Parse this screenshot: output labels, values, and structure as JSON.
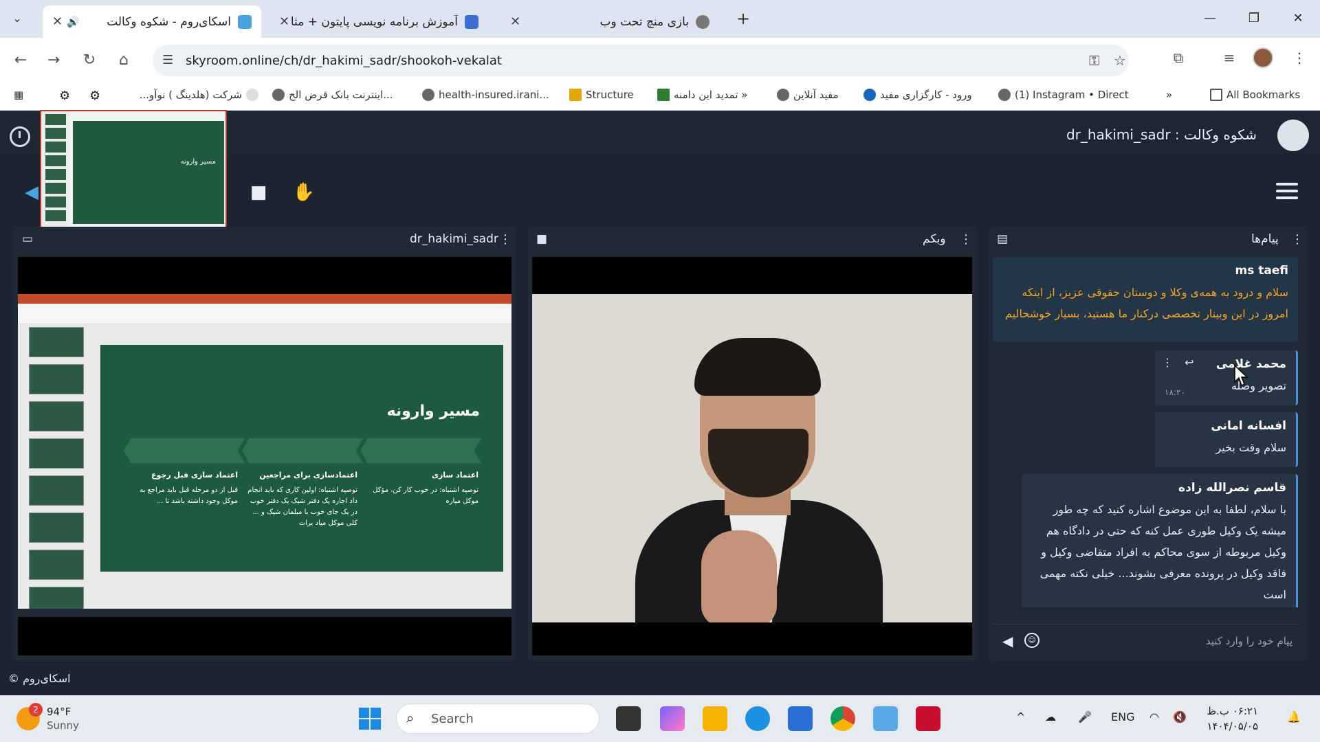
{
  "browser": {
    "tabs": [
      {
        "title": "اسکای‌روم - شکوه وکالت",
        "active": true
      },
      {
        "title": "آموزش برنامه نویسی پایتون + مثا",
        "active": false
      },
      {
        "title": "بازی منچ تحت وب",
        "active": false
      }
    ],
    "new_tab_label": "+",
    "url": "skyroom.online/ch/dr_hakimi_sadr/shookoh-vekalat",
    "window_controls": {
      "minimize": "—",
      "restore": "❐",
      "close": "✕"
    }
  },
  "bookmarks": [
    {
      "label": "شرکت (هلدینگ ) نوآو..."
    },
    {
      "label": "اینترنت بانک قرض الح..."
    },
    {
      "label": "health-insured.irani..."
    },
    {
      "label": "Structure"
    },
    {
      "label": "تمدید این دامنه »"
    },
    {
      "label": "مفید آنلاین"
    },
    {
      "label": "ورود - کارگزاری مفید"
    },
    {
      "label": "(1) Instagram • Direct"
    }
  ],
  "bookmarks_more": "»",
  "all_bookmarks": "All Bookmarks",
  "room": {
    "title": "dr_hakimi_sadr : شکوه وکالت"
  },
  "screen_panel": {
    "title": "dr_hakimi_sadr",
    "slide_title": "مسیر وارونه",
    "columns": [
      {
        "heading": "اعتماد سازی",
        "body": "توصیه اشتباه:\nدر خوب کار کن، مؤکل موکل میاره"
      },
      {
        "heading": "اعتمادسازی برای مراجعین",
        "body": "توصیه اشتباه:\nاولین کاری که باید انجام داد اجاره یک دفتر شیک یک دفتر خوب در یک جای خوب با مبلمان شیک و ... کلی موکل میاد برات"
      },
      {
        "heading": "اعتماد سازی قبل رجوع",
        "body": "قبل از دو مرحله قبل باید مراجع به موکل وجود داشته باشد تا ..."
      }
    ]
  },
  "webcam_panel": {
    "title": "وبکم"
  },
  "chat_panel": {
    "title": "پیام‌ها",
    "messages": [
      {
        "sender": "ms taefi",
        "text": "سلام و درود به همه‌ی وکلا و دوستان حقوقی عزیز، از اینکه امروز در این وبینار تخصصی درکنار ما هستید، بسیار خوشحالیم"
      },
      {
        "sender": "محمد غلامی",
        "text": "تصویر وصله",
        "time": "۱۸:۲۰"
      },
      {
        "sender": "افسانه امانی",
        "text": "سلام وقت بخیر"
      },
      {
        "sender": "قاسم نصرالله زاده",
        "text": "با سلام، لطفا به این موضوع اشاره کنید که چه طور میشه یک وکیل طوری عمل کنه که حتی در دادگاه هم وکیل مربوطه از سوی محاکم به افراد متقاضی وکیل و فاقد وکیل در پرونده معرفی بشوند... خیلی نکته مهمی است"
      }
    ],
    "input_placeholder": "پیام خود را وارد کنید"
  },
  "copyright": "© اسکای‌روم",
  "taskbar": {
    "weather_temp": "94°F",
    "weather_cond": "Sunny",
    "weather_badge": "2",
    "search_label": "Search",
    "language": "ENG",
    "time": "۰۶:۲۱ ب.ظ",
    "date": "۱۴۰۴/۰۵/۰۵"
  },
  "colors": {
    "app_bg": "#1b2430",
    "panel_bg": "#1f2a36",
    "pinned_text": "#f5a623",
    "slide_green": "#1e5a3f"
  },
  "icons": {
    "back": "back-arrow-icon",
    "forward": "forward-arrow-icon",
    "reload": "reload-icon",
    "home": "home-icon"
  }
}
